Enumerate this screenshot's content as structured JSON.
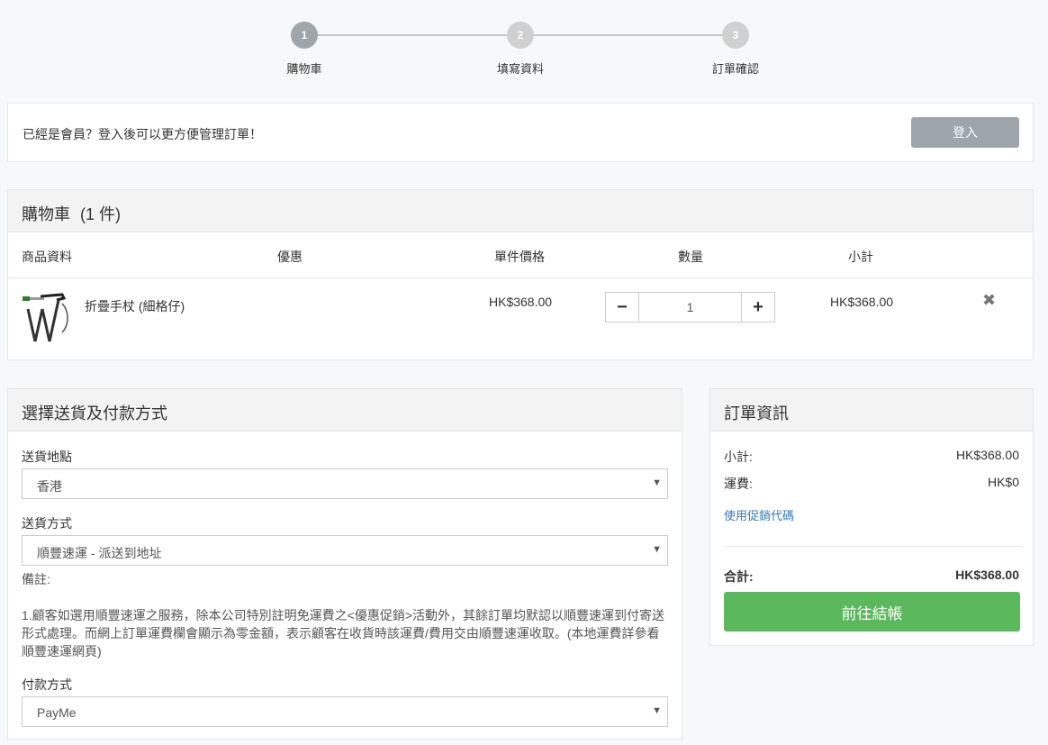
{
  "stepper": {
    "steps": [
      {
        "number": "1",
        "label": "購物車"
      },
      {
        "number": "2",
        "label": "填寫資料"
      },
      {
        "number": "3",
        "label": "訂單確認"
      }
    ]
  },
  "member": {
    "text": "已經是會員？登入後可以更方便管理訂單！",
    "login_label": "登入"
  },
  "cart": {
    "title": "購物車",
    "count": "(1 件)",
    "columns": [
      "商品資料",
      "優惠",
      "單件價格",
      "數量",
      "小計"
    ],
    "items": [
      {
        "name": "折疊手杖 (細格仔)",
        "price": "HK$368.00",
        "quantity": "1",
        "subtotal": "HK$368.00"
      }
    ]
  },
  "delivery": {
    "title": "選擇送貨及付款方式",
    "location_label": "送貨地點",
    "location_value": "香港",
    "method_label": "送貨方式",
    "method_value": "順豐速運 - 派送到地址",
    "remark_label": "備註:",
    "remark_text": "1.顧客如選用順豐速運之服務，除本公司特別註明免運費之<優惠促銷>活動外，其餘訂單均默認以順豐速運到付寄送形式處理。而網上訂單運費欄會顯示為零金額，表示顧客在收貨時該運費/費用交由順豐速運收取。(本地運費詳參看順豐速運網頁)",
    "payment_label": "付款方式",
    "payment_value": "PayMe"
  },
  "order": {
    "title": "訂單資訊",
    "subtotal_label": "小計:",
    "subtotal_value": "HK$368.00",
    "shipping_label": "運費:",
    "shipping_value": "HK$0",
    "promo_label": "使用促銷代碼",
    "total_label": "合計:",
    "total_value": "HK$368.00",
    "checkout_label": "前往結帳"
  },
  "colors": {
    "accent_green": "#5cb85c",
    "step_active": "#9ea6ac",
    "link_blue": "#337ab7"
  }
}
